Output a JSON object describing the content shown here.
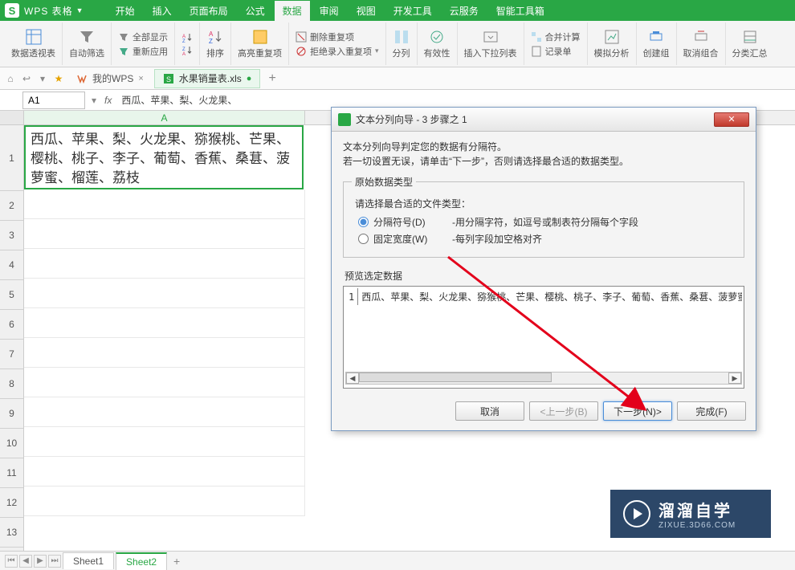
{
  "titlebar": {
    "app_name": "WPS 表格"
  },
  "menu": {
    "items": [
      "开始",
      "插入",
      "页面布局",
      "公式",
      "数据",
      "审阅",
      "视图",
      "开发工具",
      "云服务",
      "智能工具箱"
    ],
    "active_index": 4
  },
  "ribbon": {
    "pivot": "数据透视表",
    "autofilter": "自动筛选",
    "showall": "全部显示",
    "reapply": "重新应用",
    "sort": "排序",
    "highlight_dup": "高亮重复项",
    "remove_dup": "删除重复项",
    "reject_dup": "拒绝录入重复项",
    "text_to_col": "分列",
    "validation": "有效性",
    "dropdown": "插入下拉列表",
    "consolidate": "合并计算",
    "record": "记录单",
    "simulate": "模拟分析",
    "group": "创建组",
    "ungroup": "取消组合",
    "subtotal": "分类汇总"
  },
  "doctabs": {
    "mywps": "我的WPS",
    "file": "水果销量表.xls"
  },
  "fbar": {
    "cell": "A1",
    "fx": "fx",
    "formula": "西瓜、苹果、梨、火龙果、"
  },
  "grid": {
    "colA": "A",
    "rows": [
      "1",
      "2",
      "3",
      "4",
      "5",
      "6",
      "7",
      "8",
      "9",
      "10",
      "11",
      "12",
      "13"
    ],
    "cellA1": "西瓜、苹果、梨、火龙果、猕猴桃、芒果、樱桃、桃子、李子、葡萄、香蕉、桑葚、菠萝蜜、榴莲、荔枝"
  },
  "dialog": {
    "title": "文本分列向导 - 3 步骤之 1",
    "desc1": "文本分列向导判定您的数据有分隔符。",
    "desc2": "若一切设置无误，请单击“下一步”，否则请选择最合适的数据类型。",
    "group_legend": "原始数据类型",
    "choose_label": "请选择最合适的文件类型：",
    "radio1_label": "分隔符号(D)",
    "radio1_expl": "-用分隔字符，如逗号或制表符分隔每个字段",
    "radio2_label": "固定宽度(W)",
    "radio2_expl": "-每列字段加空格对齐",
    "preview_label": "预览选定数据",
    "preview_rownum": "1",
    "preview_text": "西瓜、苹果、梨、火龙果、猕猴桃、芒果、樱桃、桃子、李子、葡萄、香蕉、桑葚、菠萝蜜",
    "btn_cancel": "取消",
    "btn_prev": "<上一步(B)",
    "btn_next": "下一步(N)>",
    "btn_finish": "完成(F)"
  },
  "watermark": {
    "big": "溜溜自学",
    "small": "ZIXUE.3D66.COM"
  },
  "sheets": {
    "s1": "Sheet1",
    "s2": "Sheet2"
  }
}
